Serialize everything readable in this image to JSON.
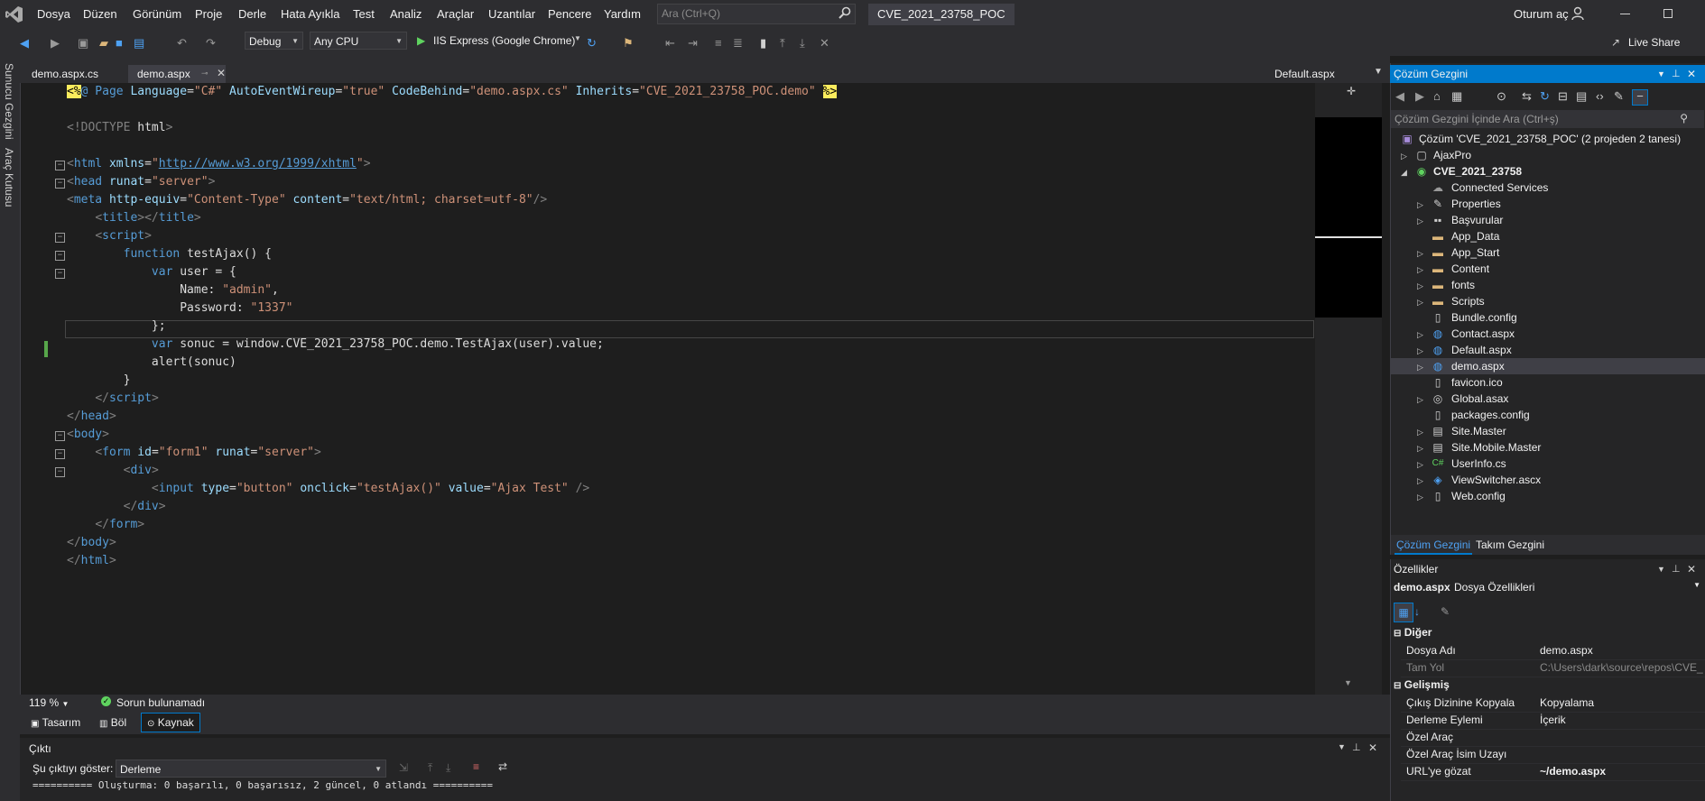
{
  "menu": {
    "items": [
      "Dosya",
      "Düzen",
      "Görünüm",
      "Proje",
      "Derle",
      "Hata Ayıkla",
      "Test",
      "Analiz",
      "Araçlar",
      "Uzantılar",
      "Pencere",
      "Yardım"
    ],
    "search_placeholder": "Ara (Ctrl+Q)",
    "solution_name": "CVE_2021_23758_POC",
    "sign_in": "Oturum aç",
    "live_share": "Live Share"
  },
  "toolbar": {
    "config": "Debug",
    "platform": "Any CPU",
    "run_target": "IIS Express (Google Chrome)"
  },
  "left_tabs": [
    "Sunucu Gezgini",
    "Araç Kutusu"
  ],
  "editor_tabs": {
    "tab1": "demo.aspx.cs",
    "tab2": "demo.aspx",
    "tab3": "Default.aspx"
  },
  "code": {
    "l1_attr1": "Language",
    "l1_val1": "\"C#\"",
    "l1_attr2": "AutoEventWireup",
    "l1_val2": "\"true\"",
    "l1_attr3": "CodeBehind",
    "l1_val3": "\"demo.aspx.cs\"",
    "l1_attr4": "Inherits",
    "l1_val4": "\"CVE_2021_23758_POC.demo\"",
    "doctype": "<!DOCTYPE",
    "doctype_html": "html",
    "xmlns_url": "http://www.w3.org/1999/xhtml",
    "meta_content": "\"text/html; charset=utf-8\"",
    "func_name": "testAjax() {",
    "var_user": "user = {",
    "name_val": "\"admin\"",
    "pass_val": "\"1337\"",
    "call_line": "sonuc = window.CVE_2021_23758_POC.demo.TestAjax(user).value;",
    "alert_line": "alert(sonuc)",
    "form_id": "\"form1\"",
    "input_type": "\"button\"",
    "input_onclick": "\"testAjax()\"",
    "input_value": "\"Ajax Test\""
  },
  "editor_status": {
    "zoom": "119 %",
    "issues": "Sorun bulunamadı"
  },
  "view_tabs": [
    "Tasarım",
    "Böl",
    "Kaynak"
  ],
  "output": {
    "title": "Çıktı",
    "show_label": "Şu çıktıyı göster:",
    "source": "Derleme",
    "line": "========== Oluşturma: 0 başarılı, 0 başarısız, 2 güncel, 0 atlandı =========="
  },
  "solution_explorer": {
    "title": "Çözüm Gezgini",
    "search_placeholder": "Çözüm Gezgini İçinde Ara (Ctrl+ş)",
    "root": "Çözüm 'CVE_2021_23758_POC' (2 projeden 2 tanesi)",
    "project1": "AjaxPro",
    "project2": "CVE_2021_23758",
    "items": [
      "Connected Services",
      "Properties",
      "Başvurular",
      "App_Data",
      "App_Start",
      "Content",
      "fonts",
      "Scripts",
      "Bundle.config",
      "Contact.aspx",
      "Default.aspx",
      "demo.aspx",
      "favicon.ico",
      "Global.asax",
      "packages.config",
      "Site.Master",
      "Site.Mobile.Master",
      "UserInfo.cs",
      "ViewSwitcher.ascx",
      "Web.config"
    ],
    "selected": "demo.aspx",
    "bottom_tab1": "Çözüm Gezgini",
    "bottom_tab2": "Takım Gezgini"
  },
  "properties": {
    "title": "Özellikler",
    "object": "demo.aspx",
    "object_type": "Dosya Özellikleri",
    "cat1": "Diğer",
    "cat2": "Gelişmiş",
    "rows": [
      {
        "name": "Dosya Adı",
        "value": "demo.aspx"
      },
      {
        "name": "Tam Yol",
        "value": "C:\\Users\\dark\\source\\repos\\CVE_"
      },
      {
        "name": "Çıkış Dizinine Kopyala",
        "value": "Kopyalama"
      },
      {
        "name": "Derleme Eylemi",
        "value": "İçerik"
      },
      {
        "name": "Özel Araç",
        "value": ""
      },
      {
        "name": "Özel Araç İsim Uzayı",
        "value": ""
      },
      {
        "name": "URL'ye gözat",
        "value": "~/demo.aspx"
      }
    ]
  }
}
